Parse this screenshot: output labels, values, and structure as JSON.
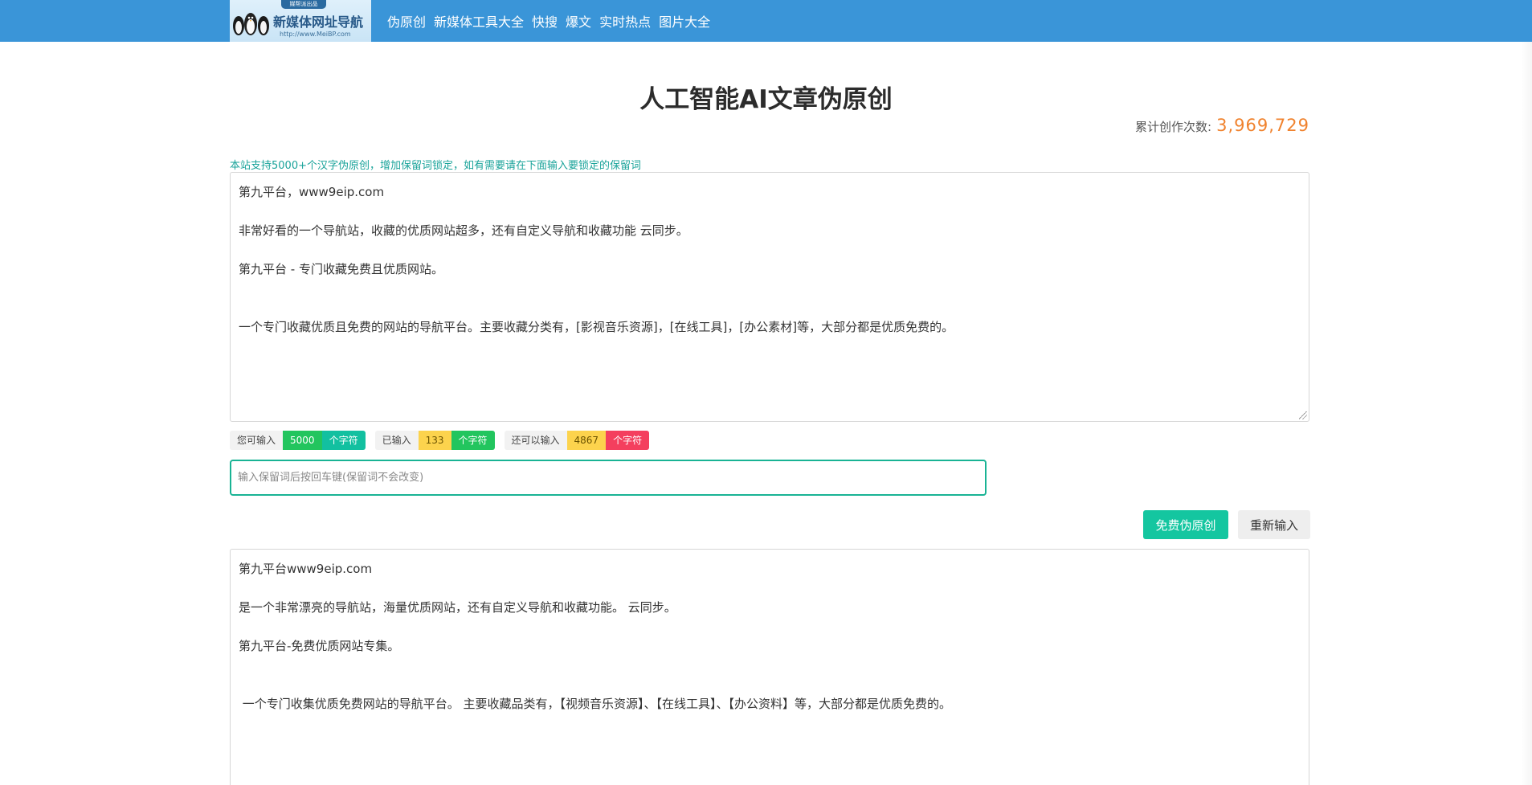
{
  "header": {
    "logo": {
      "title": "新媒体网址导航",
      "tagline": "媒帮派出品",
      "url": "http://www.MeiBP.com"
    },
    "nav": [
      "伪原创",
      "新媒体工具大全",
      "快搜",
      "爆文",
      "实时热点",
      "图片大全"
    ]
  },
  "main": {
    "title": "人工智能AI文章伪原创",
    "counter_label": "累计创作次数:",
    "counter_value": "3,969,729",
    "hint": "本站支持5000+个汉字伪原创，增加保留词锁定，如有需要请在下面输入要锁定的保留词",
    "source_lines": [
      "第九平台，www9eip.com",
      "",
      "非常好看的一个导航站，收藏的优质网站超多，还有自定义导航和收藏功能 云同步。",
      "",
      "第九平台 - 专门收藏免费且优质网站。",
      "",
      "",
      "一个专门收藏优质且免费的网站的导航平台。主要收藏分类有，[影视音乐资源]，[在线工具]，[办公素材]等，大部分都是优质免费的。"
    ],
    "counts": {
      "can_input": {
        "label": "您可输入",
        "value": "5000",
        "unit": "个字符"
      },
      "entered": {
        "label": "已输入",
        "value": "133",
        "unit": "个字符"
      },
      "remaining": {
        "label": "还可以输入",
        "value": "4867",
        "unit": "个字符"
      }
    },
    "keep_words_placeholder": "输入保留词后按回车键(保留词不会改变)",
    "buttons": {
      "rewrite": "免费伪原创",
      "reset": "重新输入"
    },
    "output_lines": [
      "第九平台www9eip.com",
      "",
      "是一个非常漂亮的导航站，海量优质网站，还有自定义导航和收藏功能。 云同步。",
      "",
      "第九平台-免费优质网站专集。",
      "",
      "",
      " 一个专门收集优质免费网站的导航平台。 主要收藏品类有，【视频音乐资源】、【在线工具】、【办公资料】等，大部分都是优质免费的。"
    ]
  }
}
